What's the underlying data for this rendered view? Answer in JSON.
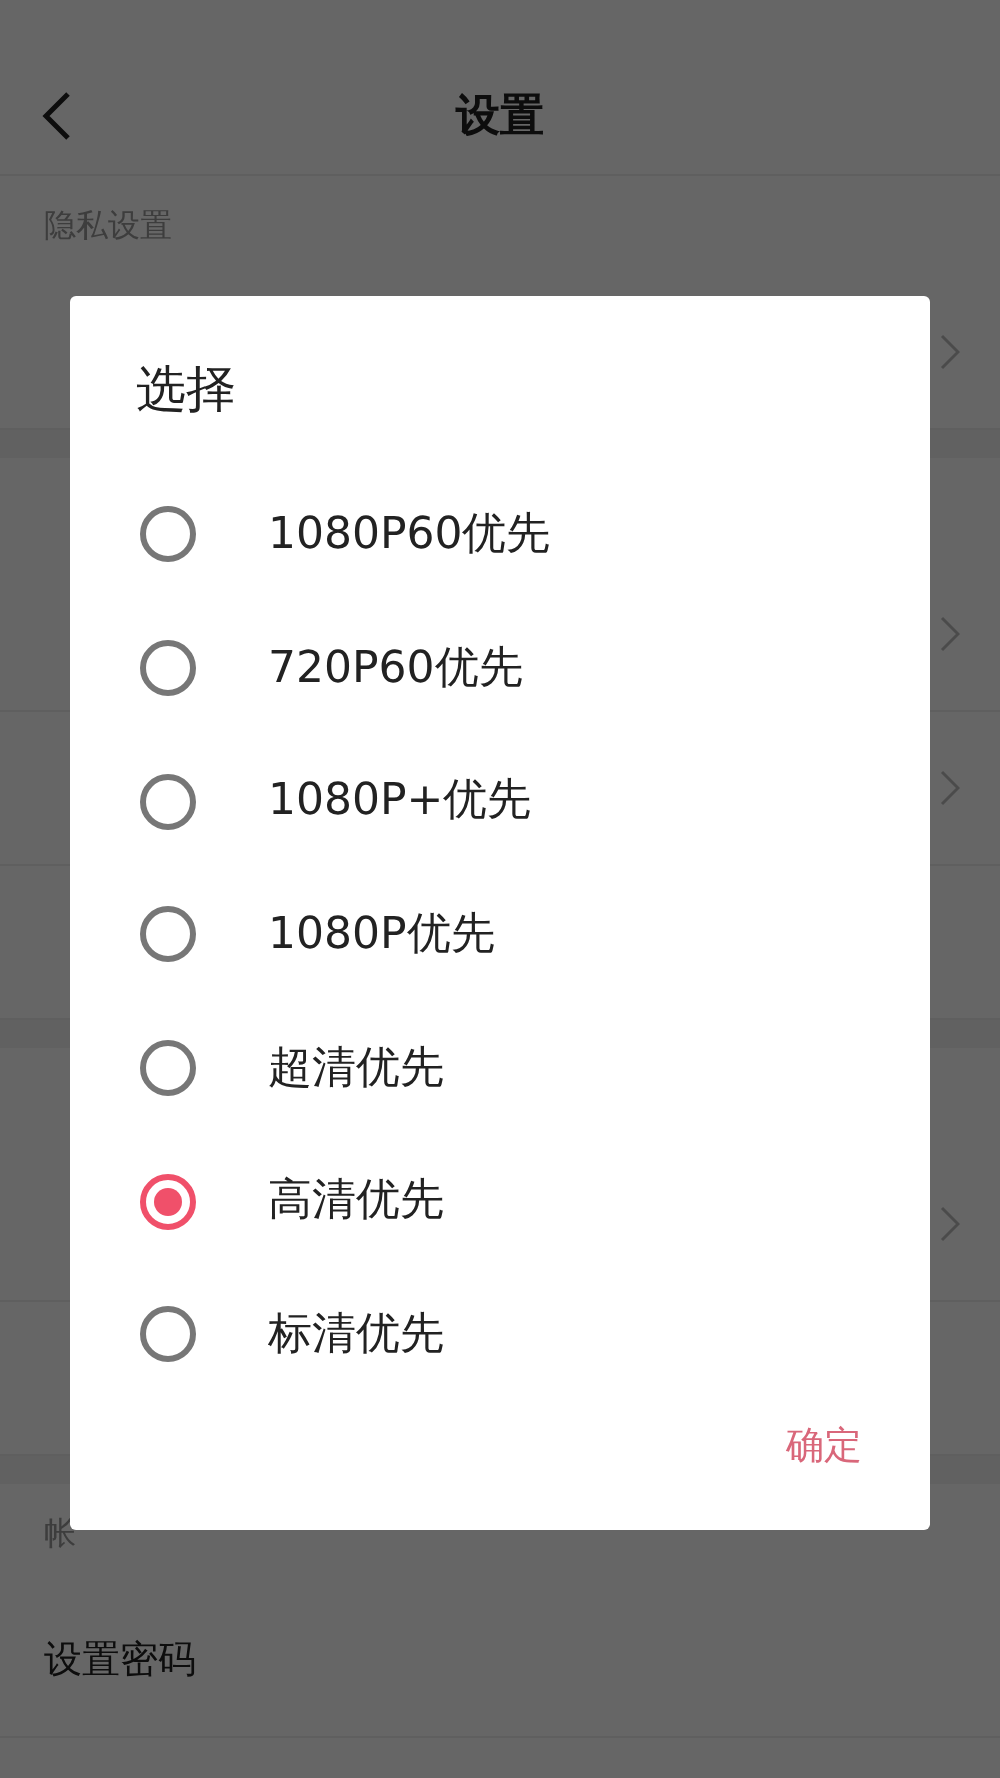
{
  "header": {
    "title": "设置"
  },
  "sections": [
    {
      "heading": "隐私设置",
      "rows": [
        {
          "chevron": true
        }
      ]
    },
    {
      "rows": [
        {
          "chevron": true
        },
        {
          "chevron": true
        },
        {
          "chevron": false
        }
      ]
    },
    {
      "rows": [
        {
          "chevron": true
        },
        {
          "chevron": false
        }
      ]
    },
    {
      "heading": "帐",
      "rows": [
        {
          "label": "设置密码",
          "chevron": false
        }
      ]
    }
  ],
  "dialog": {
    "title": "选择",
    "options": [
      {
        "label": "1080P60优先",
        "selected": false
      },
      {
        "label": "720P60优先",
        "selected": false
      },
      {
        "label": "1080P+优先",
        "selected": false
      },
      {
        "label": "1080P优先",
        "selected": false
      },
      {
        "label": "超清优先",
        "selected": false
      },
      {
        "label": "高清优先",
        "selected": true
      },
      {
        "label": "标清优先",
        "selected": false
      }
    ],
    "confirm": "确定"
  }
}
